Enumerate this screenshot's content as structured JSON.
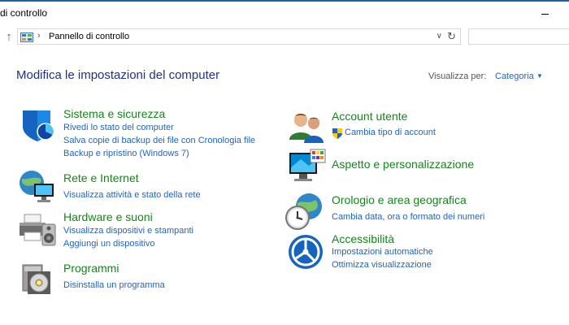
{
  "window": {
    "title": "di controllo"
  },
  "address": {
    "path": "Pannello di controllo"
  },
  "header": {
    "title": "Modifica le impostazioni del computer",
    "view_label": "Visualizza per:",
    "view_value": "Categoria"
  },
  "categories": {
    "system": {
      "title": "Sistema e sicurezza",
      "links": [
        "Rivedi lo stato del computer",
        "Salva copie di backup dei file con Cronologia file",
        "Backup e ripristino (Windows 7)"
      ]
    },
    "network": {
      "title": "Rete e Internet",
      "links": [
        "Visualizza attività e stato della rete"
      ]
    },
    "hardware": {
      "title": "Hardware e suoni",
      "links": [
        "Visualizza dispositivi e stampanti",
        "Aggiungi un dispositivo"
      ]
    },
    "programs": {
      "title": "Programmi",
      "links": [
        "Disinstalla un programma"
      ]
    },
    "accounts": {
      "title": "Account utente",
      "links": [
        "Cambia tipo di account"
      ]
    },
    "appearance": {
      "title": "Aspetto e personalizzazione",
      "links": []
    },
    "clock": {
      "title": "Orologio e area geografica",
      "links": [
        "Cambia data, ora o formato dei numeri"
      ]
    },
    "access": {
      "title": "Accessibilità",
      "links": [
        "Impostazioni automatiche",
        "Ottimizza visualizzazione"
      ]
    }
  },
  "colors": {
    "title_blue": "#1e3287",
    "link_blue": "#1e64c8",
    "category_green": "#13861a",
    "window_accent": "#1f5fa8"
  },
  "icons": [
    "up-arrow-icon",
    "control-panel-icon",
    "chevron-down-icon",
    "refresh-icon",
    "shield-icon",
    "globe-network-icon",
    "printer-speaker-icon",
    "programs-disc-icon",
    "users-icon",
    "appearance-monitor-icon",
    "clock-globe-icon",
    "accessibility-icon",
    "uac-shield-icon"
  ]
}
